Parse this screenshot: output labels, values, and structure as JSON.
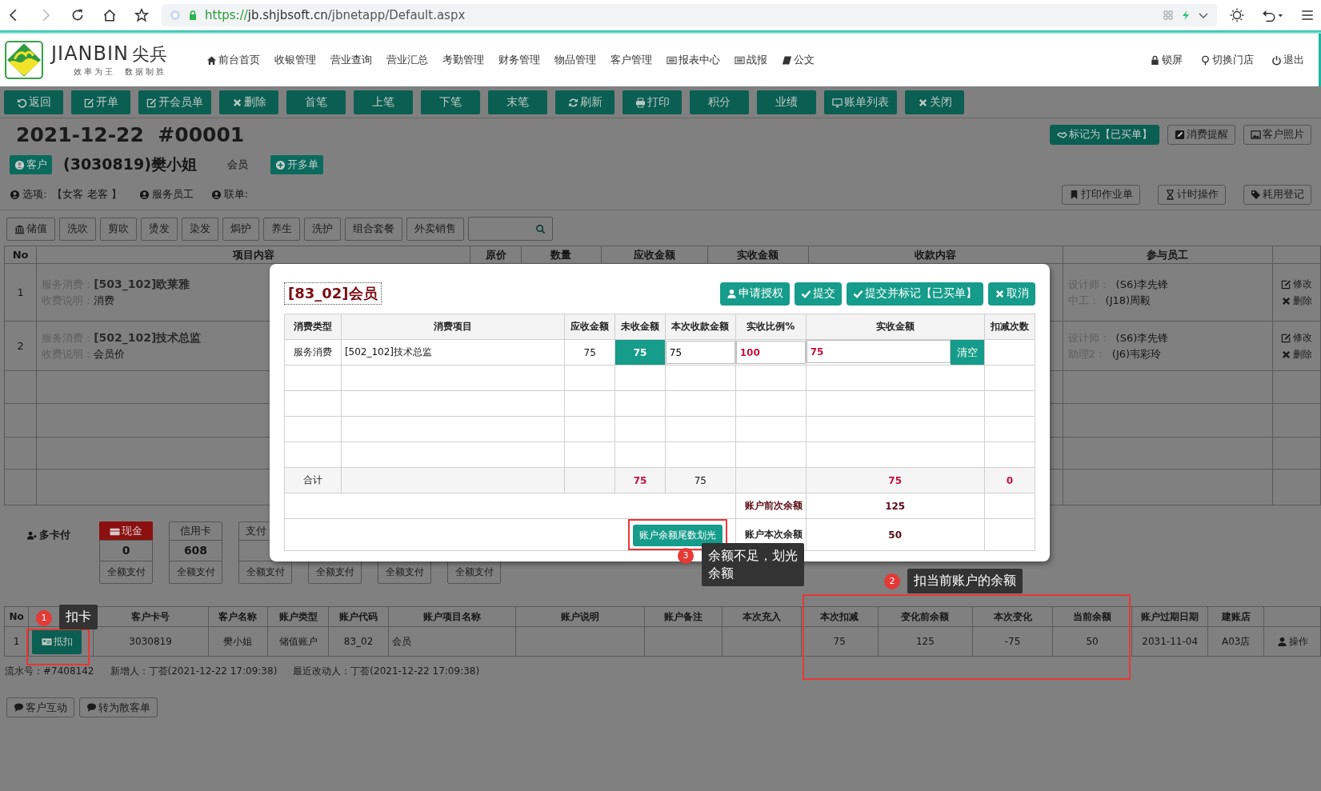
{
  "browser": {
    "url_scheme": "https://",
    "url_host": "jb.shjbsoft.cn",
    "url_path": "/jbnetapp/Default.aspx"
  },
  "header": {
    "logo_text": "JIANBIN",
    "logo_cn": "尖兵",
    "slogan": "效率为王  数据制胜",
    "nav": [
      "前台首页",
      "收银管理",
      "营业查询",
      "营业汇总",
      "考勤管理",
      "财务管理",
      "物品管理",
      "客户管理",
      "报表中心",
      "战报",
      "公文"
    ],
    "right": [
      "锁屏",
      "切换门店",
      "退出"
    ]
  },
  "toolbar": [
    "返回",
    "开单",
    "开会员单",
    "删除",
    "首笔",
    "上笔",
    "下笔",
    "末笔",
    "刷新",
    "打印",
    "积分",
    "业绩",
    "账单列表",
    "关闭"
  ],
  "title": "2021-12-22  #00001",
  "customer": {
    "tag": "客户",
    "name": "(3030819)樊小姐",
    "level": "会员",
    "multi_button": "开多单"
  },
  "options": [
    {
      "label": "选项:",
      "value": "【女客 老客 】"
    },
    {
      "label": "服务员工"
    },
    {
      "label": "联单:"
    }
  ],
  "right_buttons": [
    {
      "label": "标记为【已买单】",
      "primary": true
    },
    {
      "label": "消费提醒",
      "primary": false
    },
    {
      "label": "客户照片",
      "primary": false
    }
  ],
  "right_buttons_second": [
    "打印作业单",
    "计时操作",
    "耗用登记"
  ],
  "categories": [
    "储值",
    "洗吹",
    "剪吹",
    "烫发",
    "染发",
    "焗护",
    "养生",
    "洗护",
    "组合套餐",
    "外卖销售"
  ],
  "order_table": {
    "columns": [
      "No",
      "项目内容",
      "原价",
      "数量",
      "应收金额",
      "实收金额",
      "收款内容",
      "参与员工"
    ],
    "rows": [
      {
        "no": "1",
        "item_label": "服务消费：",
        "item": "[503_102]欧莱雅",
        "note_label": "收费说明：",
        "note": "消费",
        "staff": [
          {
            "role": "设计师：",
            "name": "(S6)李先锋"
          },
          {
            "role": "中工：",
            "name": "(J18)周毅"
          }
        ],
        "actions": [
          "修改",
          "删除"
        ]
      },
      {
        "no": "2",
        "item_label": "服务消费：",
        "item": "[502_102]技术总监",
        "note_label": "收费说明：",
        "note": "会员价",
        "staff": [
          {
            "role": "设计师：",
            "name": "(S6)李先锋"
          },
          {
            "role": "助理2：",
            "name": "(J6)韦彩玲"
          }
        ],
        "actions": [
          "修改",
          "删除"
        ]
      }
    ]
  },
  "payment": {
    "label": "多卡付",
    "cards": [
      {
        "name": "现金",
        "amount": "0",
        "selected": true,
        "button": "全额支付"
      },
      {
        "name": "信用卡",
        "amount": "608",
        "selected": false,
        "button": "全额支付"
      },
      {
        "name": "支付",
        "selected": false,
        "button": "全额支付"
      },
      {
        "button": "全额支付"
      },
      {
        "button": "全额支付"
      },
      {
        "button": "全额支付"
      }
    ]
  },
  "accounts": {
    "columns": [
      "No",
      "",
      "客户卡号",
      "客户名称",
      "账户类型",
      "账户代码",
      "账户项目名称",
      "账户说明",
      "账户备注",
      "本次充入",
      "本次扣减",
      "变化前余额",
      "本次变化",
      "当前余额",
      "账户过期日期",
      "建账店",
      ""
    ],
    "rows": [
      {
        "no": "1",
        "action": "抵扣",
        "card_no": "3030819",
        "name": "樊小姐",
        "type": "储值账户",
        "code": "83_02",
        "item_name": "会员",
        "deduct": "75",
        "before": "125",
        "change": "-75",
        "current": "50",
        "expiry": "2031-11-04",
        "store": "A03店",
        "op": "操作"
      }
    ]
  },
  "record": [
    "流水号：#7408142",
    "新增人：丁荟(2021-12-22 17:09:38)",
    "最近改动人：丁荟(2021-12-22 17:09:38)"
  ],
  "bottom_buttons": [
    "客户互动",
    "转为散客单"
  ],
  "modal": {
    "title": "[83_02]会员",
    "buttons": [
      "申请授权",
      "提交",
      "提交并标记【已买单】",
      "取消"
    ],
    "columns": [
      "消费类型",
      "消费项目",
      "应收金额",
      "未收金额",
      "本次收款金额",
      "实收比例%",
      "实收金额",
      "扣减次数"
    ],
    "row": {
      "type": "服务消费",
      "item": "[502_102]技术总监",
      "due": "75",
      "unpaid": "75",
      "payment": "75",
      "ratio": "100",
      "received": "75",
      "clear": "清空"
    },
    "total": {
      "label": "合计",
      "unpaid": "75",
      "payment": "75",
      "received": "75",
      "count": "0"
    },
    "balance_before": {
      "label": "账户前次余额",
      "value": "125"
    },
    "balance_after": {
      "label": "账户本次余额",
      "value": "50"
    },
    "clear_balance_button": "账户余额尾数划光"
  },
  "annotations": [
    {
      "number": "1",
      "text": "扣卡"
    },
    {
      "number": "2",
      "text": "扣当前账户的余额"
    },
    {
      "number": "3",
      "text": "余额不足，划光余额"
    }
  ]
}
